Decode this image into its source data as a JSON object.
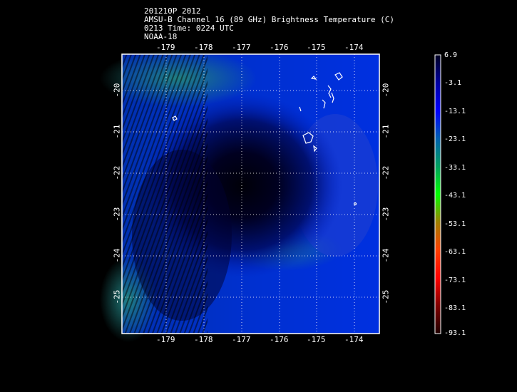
{
  "header": {
    "line1": "201210P 2012",
    "line2": "AMSU-B Channel 16 (89 GHz) Brightness Temperature (C)",
    "line3": "0213 Time: 0224 UTC",
    "line4": "NOAA-18"
  },
  "map": {
    "lon_ticks": [
      "-179",
      "-178",
      "-177",
      "-176",
      "-175",
      "-174"
    ],
    "lat_ticks": [
      "-20",
      "-21",
      "-22",
      "-23",
      "-24",
      "-25"
    ]
  },
  "colorbar": {
    "labels": [
      "6.9",
      "-3.1",
      "-13.1",
      "-23.1",
      "-33.1",
      "-43.1",
      "-53.1",
      "-63.1",
      "-73.1",
      "-83.1",
      "-93.1"
    ],
    "colors": [
      "#000020",
      "#0000a0",
      "#0000ff",
      "#0060b0",
      "#00a060",
      "#00ff00",
      "#a08000",
      "#ff4000",
      "#ff0000",
      "#800000",
      "#200000"
    ]
  }
}
